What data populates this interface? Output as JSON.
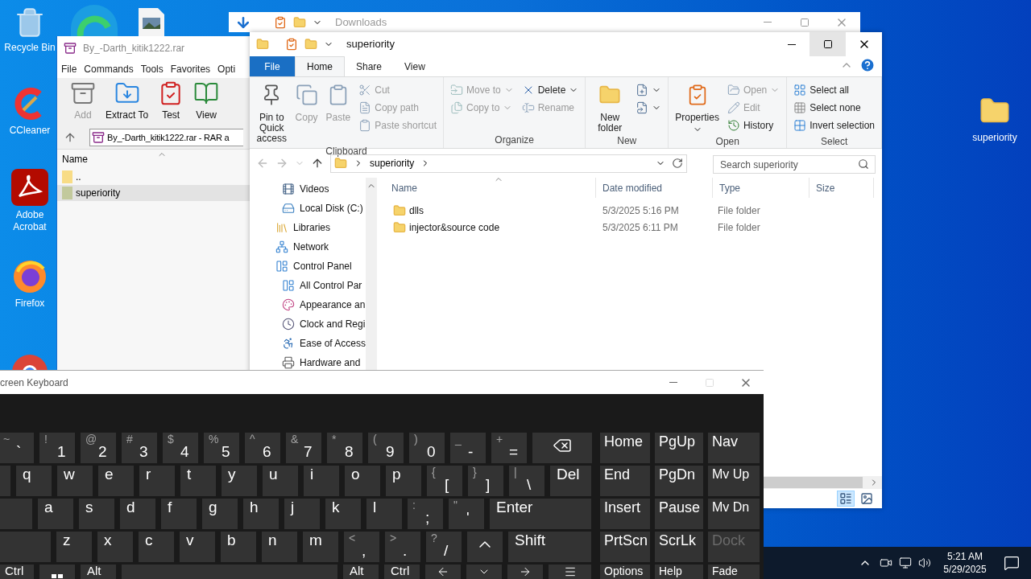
{
  "desktop_icons": [
    {
      "label": "Recycle Bin",
      "kind": "recycle"
    },
    {
      "label": "CCleaner",
      "kind": "ccleaner"
    },
    {
      "label": "Adobe Acrobat",
      "kind": "acrobat"
    },
    {
      "label": "Firefox",
      "kind": "firefox"
    }
  ],
  "desktop_right_icon": {
    "label": "superiority"
  },
  "downloads_window": {
    "title": "Downloads"
  },
  "winrar": {
    "title": "By_-Darth_kitik1222.rar",
    "menu": [
      "File",
      "Commands",
      "Tools",
      "Favorites",
      "Opti"
    ],
    "toolbar": [
      {
        "label": "Add",
        "kind": "add",
        "disabled": true
      },
      {
        "label": "Extract To",
        "kind": "extract",
        "disabled": false
      },
      {
        "label": "Test",
        "kind": "test",
        "disabled": false
      },
      {
        "label": "View",
        "kind": "view",
        "disabled": false
      }
    ],
    "address": "By_-Darth_kitik1222.rar - RAR a",
    "column": "Name",
    "rows": [
      {
        "name": "..",
        "selected": false,
        "kind": "parent"
      },
      {
        "name": "superiority",
        "selected": true,
        "kind": "folder"
      }
    ]
  },
  "explorer": {
    "title": "superiority",
    "tabs": [
      {
        "label": "File",
        "selected": false,
        "kind": "file"
      },
      {
        "label": "Home",
        "selected": true,
        "kind": "tab"
      },
      {
        "label": "Share",
        "selected": false,
        "kind": "tab"
      },
      {
        "label": "View",
        "selected": false,
        "kind": "tab"
      }
    ],
    "ribbon_groups": [
      {
        "label": "Clipboard",
        "columns": [
          {
            "kind": "big",
            "items": [
              {
                "label": "Pin to Quick access",
                "kind": "pin",
                "disabled": false,
                "dropdown": false
              }
            ]
          },
          {
            "kind": "big",
            "items": [
              {
                "label": "Copy",
                "kind": "copy",
                "disabled": true,
                "dropdown": false
              }
            ]
          },
          {
            "kind": "big",
            "items": [
              {
                "label": "Paste",
                "kind": "paste",
                "disabled": true,
                "dropdown": false
              }
            ]
          },
          {
            "kind": "small",
            "items": [
              {
                "label": "Cut",
                "kind": "cut",
                "disabled": true,
                "dropdown": false
              },
              {
                "label": "Copy path",
                "kind": "copy_path",
                "disabled": true,
                "dropdown": false
              },
              {
                "label": "Paste shortcut",
                "kind": "paste_shortcut",
                "disabled": true,
                "dropdown": false
              }
            ]
          }
        ]
      },
      {
        "label": "Organize",
        "columns": [
          {
            "kind": "small",
            "items": [
              {
                "label": "Move to",
                "kind": "move",
                "disabled": true,
                "dropdown": true
              },
              {
                "label": "Copy to",
                "kind": "copy_to",
                "disabled": true,
                "dropdown": true
              }
            ]
          },
          {
            "kind": "small",
            "items": [
              {
                "label": "Delete",
                "kind": "delete",
                "disabled": false,
                "dropdown": true
              },
              {
                "label": "Rename",
                "kind": "rename",
                "disabled": true,
                "dropdown": false
              }
            ]
          }
        ]
      },
      {
        "label": "New",
        "columns": [
          {
            "kind": "big",
            "items": [
              {
                "label": "New folder",
                "kind": "new_folder",
                "disabled": false,
                "dropdown": false
              }
            ]
          },
          {
            "kind": "small",
            "items": [
              {
                "kind": "new_item",
                "disabled": false,
                "dropdown": true
              },
              {
                "kind": "easy_access",
                "disabled": false,
                "dropdown": true
              }
            ]
          }
        ]
      },
      {
        "label": "Open",
        "columns": [
          {
            "kind": "big",
            "items": [
              {
                "label": "Properties",
                "kind": "properties",
                "disabled": false,
                "dropdown": true
              }
            ]
          },
          {
            "kind": "small",
            "items": [
              {
                "label": "Open",
                "kind": "open",
                "disabled": true,
                "dropdown": true
              },
              {
                "label": "Edit",
                "kind": "edit",
                "disabled": true,
                "dropdown": false
              },
              {
                "label": "History",
                "kind": "history",
                "disabled": false,
                "dropdown": false
              }
            ]
          }
        ]
      },
      {
        "label": "Select",
        "columns": [
          {
            "kind": "small",
            "items": [
              {
                "label": "Select all",
                "kind": "select_all",
                "disabled": false,
                "dropdown": false
              },
              {
                "label": "Select none",
                "kind": "select_none",
                "disabled": false,
                "dropdown": false
              },
              {
                "label": "Invert selection",
                "kind": "invert",
                "disabled": false,
                "dropdown": false
              }
            ]
          }
        ]
      }
    ],
    "breadcrumb": "superiority",
    "search": {
      "placeholder": "Search superiority"
    },
    "nav_continued": [
      {
        "label": "Videos",
        "kind": "videos"
      },
      {
        "label": "Local Disk (C:)",
        "kind": "disk"
      }
    ],
    "nav": [
      {
        "label": "Libraries",
        "kind": "libraries"
      },
      {
        "label": "Network",
        "kind": "network"
      },
      {
        "label": "Control Panel",
        "kind": "control",
        "children": [
          {
            "label": "All Control Par",
            "kind": "control"
          },
          {
            "label": "Appearance an",
            "kind": "appearance"
          },
          {
            "label": "Clock and Regi",
            "kind": "clock"
          },
          {
            "label": "Ease of Access",
            "kind": "ease"
          },
          {
            "label": "Hardware and",
            "kind": "hardware"
          }
        ]
      }
    ],
    "columns": [
      "Name",
      "Date modified",
      "Type",
      "Size"
    ],
    "files": [
      {
        "name": "dlls",
        "date": "5/3/2025 5:16 PM",
        "type": "File folder",
        "selected": false
      },
      {
        "name": "injector&source code",
        "date": "5/3/2025 6:11 PM",
        "type": "File folder",
        "selected": false
      }
    ]
  },
  "keyboard": {
    "title": "creen Keyboard",
    "rows": [
      [
        {
          "kind": "char",
          "shift": "~",
          "main": "`"
        },
        {
          "kind": "char",
          "shift": "!",
          "main": "1"
        },
        {
          "kind": "char",
          "shift": "@",
          "main": "2"
        },
        {
          "kind": "char",
          "shift": "#",
          "main": "3"
        },
        {
          "kind": "char",
          "shift": "$",
          "main": "4"
        },
        {
          "kind": "char",
          "shift": "%",
          "main": "5"
        },
        {
          "kind": "char",
          "shift": "^",
          "main": "6"
        },
        {
          "kind": "char",
          "shift": "&",
          "main": "7"
        },
        {
          "kind": "char",
          "shift": "*",
          "main": "8"
        },
        {
          "kind": "char",
          "shift": "(",
          "main": "9"
        },
        {
          "kind": "char",
          "shift": ")",
          "main": "0"
        },
        {
          "kind": "char",
          "shift": "_",
          "main": "-"
        },
        {
          "kind": "char",
          "shift": "+",
          "main": "="
        },
        {
          "kind": "backspace"
        }
      ],
      [
        {
          "kind": "blank"
        },
        {
          "kind": "letter",
          "main": "q"
        },
        {
          "kind": "letter",
          "main": "w"
        },
        {
          "kind": "letter",
          "main": "e"
        },
        {
          "kind": "letter",
          "main": "r"
        },
        {
          "kind": "letter",
          "main": "t"
        },
        {
          "kind": "letter",
          "main": "y"
        },
        {
          "kind": "letter",
          "main": "u"
        },
        {
          "kind": "letter",
          "main": "i"
        },
        {
          "kind": "letter",
          "main": "o"
        },
        {
          "kind": "letter",
          "main": "p"
        },
        {
          "kind": "char",
          "shift": "{",
          "main": "["
        },
        {
          "kind": "char",
          "shift": "}",
          "main": "]"
        },
        {
          "kind": "char",
          "shift": "|",
          "main": "\\"
        },
        {
          "kind": "del",
          "main": "Del"
        }
      ],
      [
        {
          "kind": "blank"
        },
        {
          "kind": "letter",
          "main": "a"
        },
        {
          "kind": "letter",
          "main": "s"
        },
        {
          "kind": "letter",
          "main": "d"
        },
        {
          "kind": "letter",
          "main": "f"
        },
        {
          "kind": "letter",
          "main": "g"
        },
        {
          "kind": "letter",
          "main": "h"
        },
        {
          "kind": "letter",
          "main": "j"
        },
        {
          "kind": "letter",
          "main": "k"
        },
        {
          "kind": "letter",
          "main": "l"
        },
        {
          "kind": "char",
          "shift": ":",
          "main": ";"
        },
        {
          "kind": "char",
          "shift": "\"",
          "main": "'"
        },
        {
          "kind": "enter",
          "main": "Enter"
        }
      ],
      [
        {
          "kind": "lshift"
        },
        {
          "kind": "letter",
          "main": "z"
        },
        {
          "kind": "letter",
          "main": "x"
        },
        {
          "kind": "letter",
          "main": "c"
        },
        {
          "kind": "letter",
          "main": "v"
        },
        {
          "kind": "letter",
          "main": "b"
        },
        {
          "kind": "letter",
          "main": "n"
        },
        {
          "kind": "letter",
          "main": "m"
        },
        {
          "kind": "char",
          "shift": "<",
          "main": ","
        },
        {
          "kind": "char",
          "shift": ">",
          "main": "."
        },
        {
          "kind": "char",
          "shift": "?",
          "main": "/"
        },
        {
          "kind": "up"
        },
        {
          "kind": "shift",
          "main": "Shift"
        }
      ],
      [
        {
          "kind": "letter",
          "main": "Ctrl"
        },
        {
          "kind": "win"
        },
        {
          "kind": "letter",
          "main": "Alt"
        },
        {
          "kind": "space"
        },
        {
          "kind": "letter",
          "main": "Alt"
        },
        {
          "kind": "letter",
          "main": "Ctrl"
        },
        {
          "kind": "left"
        },
        {
          "kind": "down"
        },
        {
          "kind": "right"
        },
        {
          "kind": "menu"
        }
      ]
    ],
    "nav_keys": [
      [
        {
          "label": "Home",
          "disabled": false
        },
        {
          "label": "PgUp",
          "disabled": false
        },
        {
          "label": "Nav",
          "disabled": false
        }
      ],
      [
        {
          "label": "End",
          "disabled": false
        },
        {
          "label": "PgDn",
          "disabled": false
        },
        {
          "label": "Mv Up",
          "disabled": false
        }
      ],
      [
        {
          "label": "Insert",
          "disabled": false
        },
        {
          "label": "Pause",
          "disabled": false
        },
        {
          "label": "Mv Dn",
          "disabled": false
        }
      ],
      [
        {
          "label": "PrtScn",
          "disabled": false
        },
        {
          "label": "ScrLk",
          "disabled": false
        },
        {
          "label": "Dock",
          "disabled": true
        }
      ],
      [
        {
          "label": "Options",
          "disabled": false
        },
        {
          "label": "Help",
          "disabled": false
        },
        {
          "label": "Fade",
          "disabled": false
        }
      ]
    ]
  },
  "taskbar": {
    "time": "5:21 AM",
    "date": "5/29/2025"
  }
}
